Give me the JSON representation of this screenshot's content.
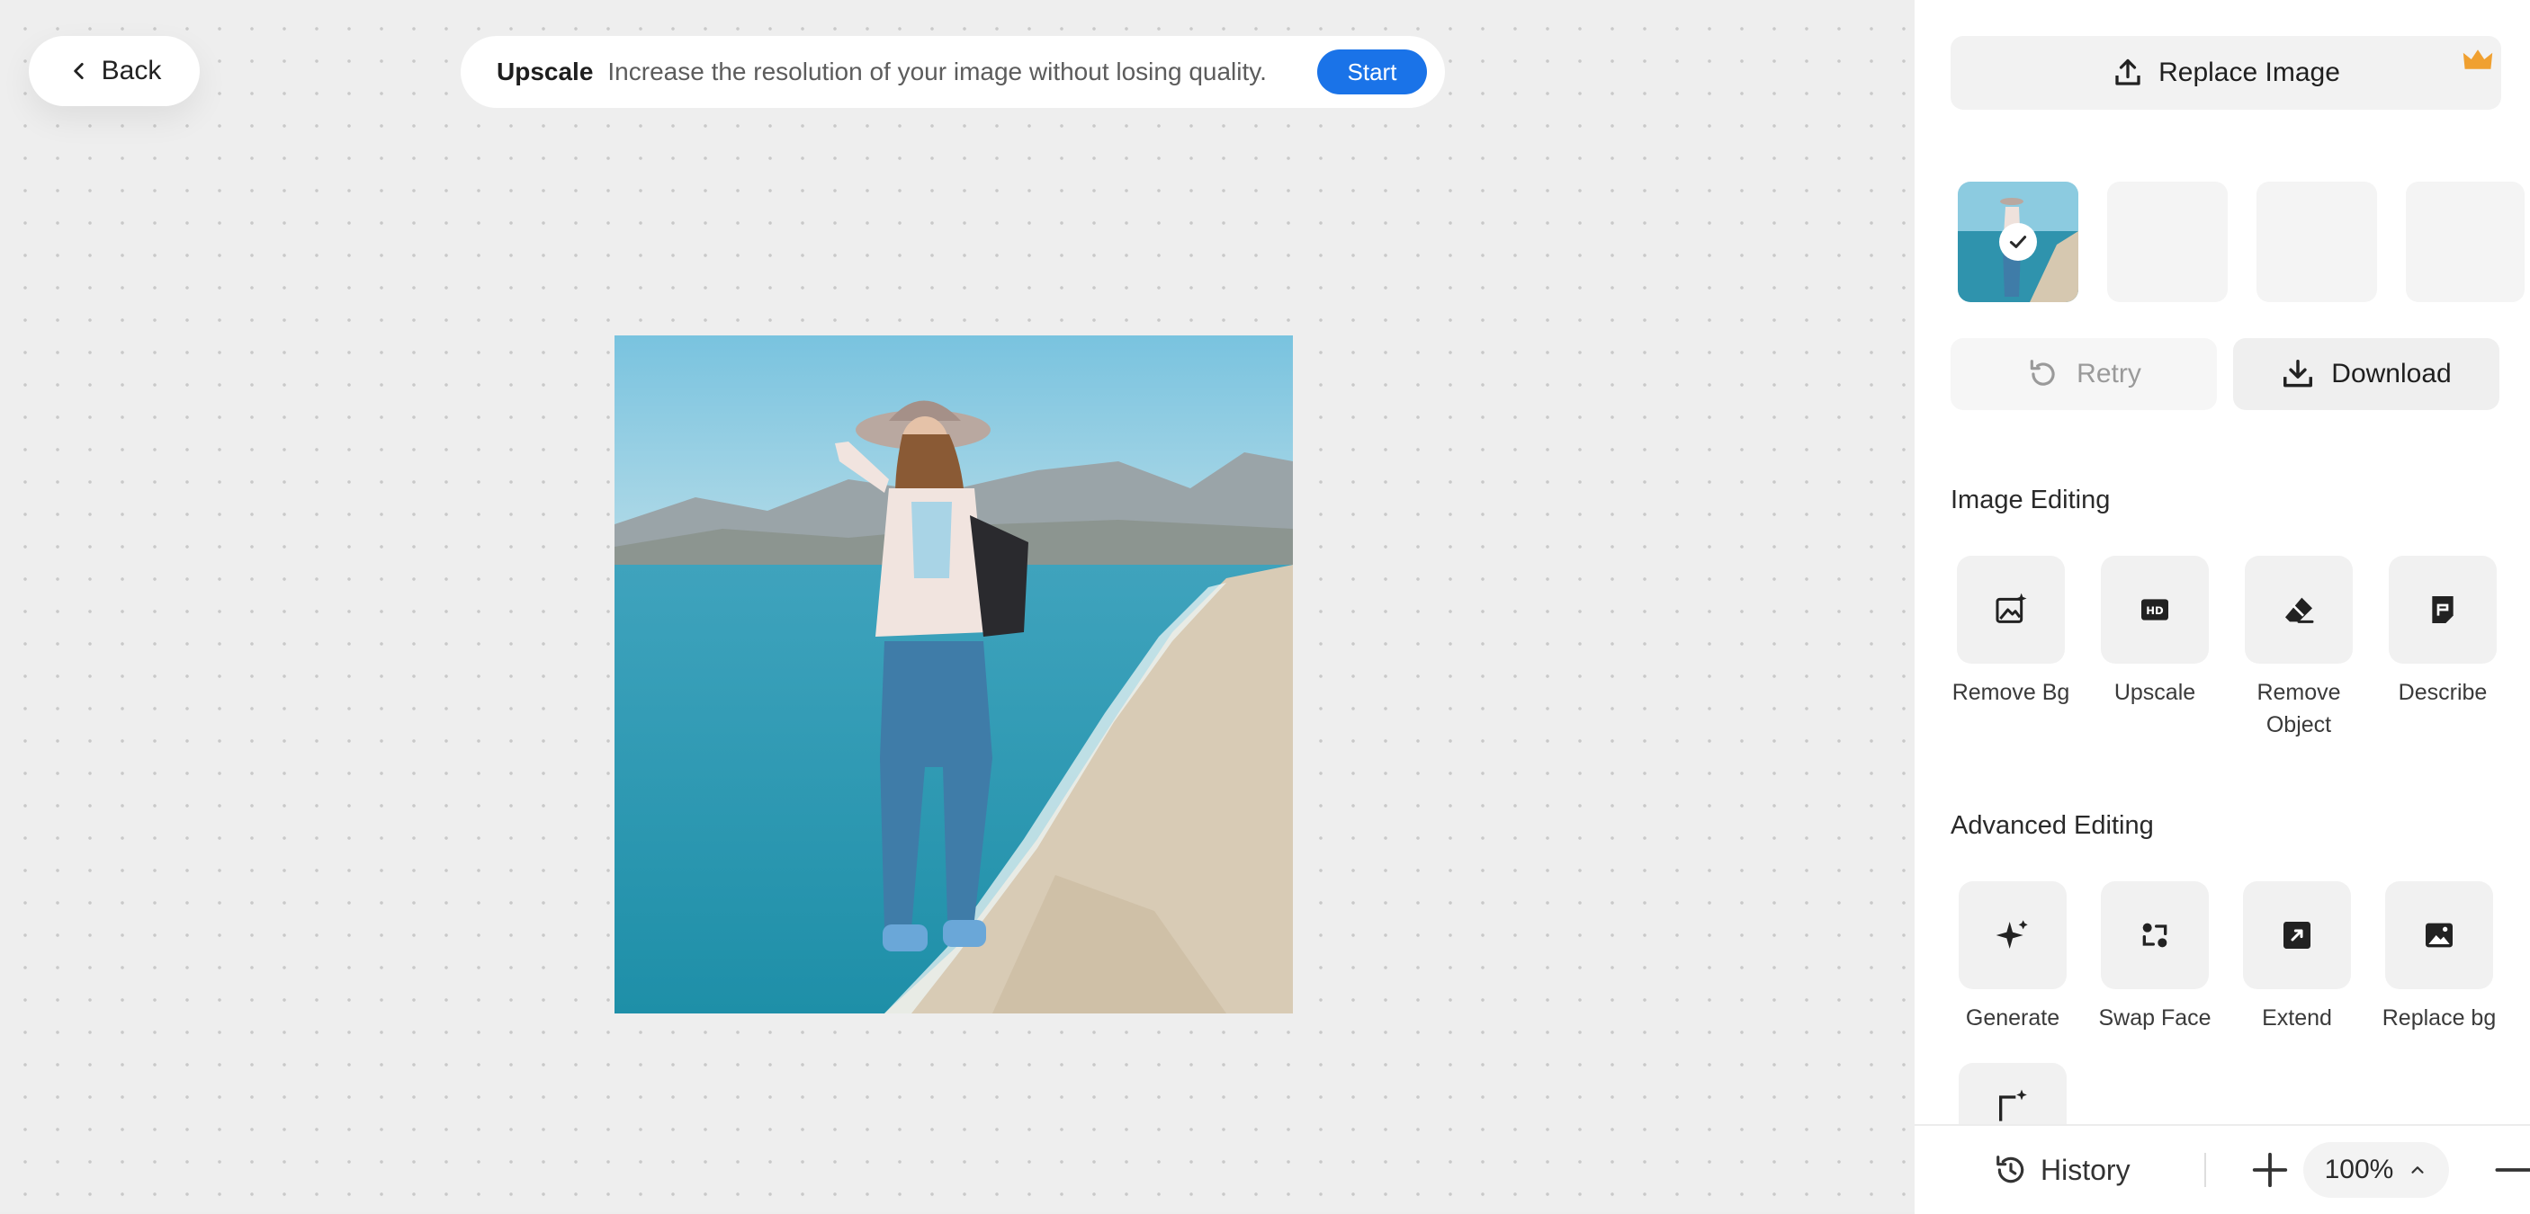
{
  "nav": {
    "back_label": "Back"
  },
  "banner": {
    "title": "Upscale",
    "description": "Increase the resolution of your image without losing quality.",
    "start_label": "Start"
  },
  "panel": {
    "replace_label": "Replace Image",
    "retry_label": "Retry",
    "download_label": "Download",
    "image_editing_title": "Image Editing",
    "image_editing_tools": [
      {
        "label": "Remove Bg",
        "icon": "image-sparkle-icon"
      },
      {
        "label": "Upscale",
        "icon": "hd-icon"
      },
      {
        "label": "Remove Object",
        "icon": "eraser-icon"
      },
      {
        "label": "Describe",
        "icon": "describe-icon"
      }
    ],
    "advanced_editing_title": "Advanced Editing",
    "advanced_editing_tools": [
      {
        "label": "Generate",
        "icon": "sparkle-icon"
      },
      {
        "label": "Swap Face",
        "icon": "swap-face-icon"
      },
      {
        "label": "Extend",
        "icon": "extend-icon"
      },
      {
        "label": "Replace bg",
        "icon": "replace-bg-icon"
      }
    ]
  },
  "footer": {
    "history_label": "History",
    "zoom_level": "100%"
  },
  "colors": {
    "accent": "#1a73e8",
    "crown": "#f0a030"
  }
}
